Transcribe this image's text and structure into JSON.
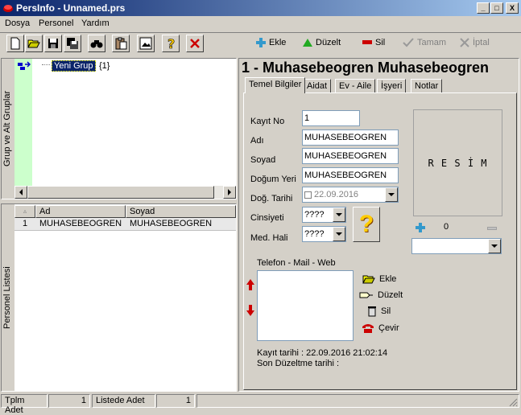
{
  "window": {
    "title": "PersInfo - Unnamed.prs",
    "min": "_",
    "max": "□",
    "close": "X"
  },
  "menu": [
    "Dosya",
    "Personel",
    "Yardım"
  ],
  "actions": {
    "ekle": "Ekle",
    "duzelt": "Düzelt",
    "sil": "Sil",
    "tamam": "Tamam",
    "iptal": "İptal"
  },
  "groups_panel": {
    "label": "Grup ve Alt Gruplar",
    "tree_item": "Yeni Grup",
    "tree_count": "{1}"
  },
  "personel_panel": {
    "label": "Personel Listesi",
    "columns": [
      "Ad",
      "Soyad"
    ],
    "rows": [
      {
        "no": "1",
        "ad": "MUHASEBEOGREN",
        "soyad": "MUHASEBEOGREN"
      }
    ]
  },
  "record": {
    "header": "1 - Muhasebeogren Muhasebeogren",
    "tabs": [
      "Temel Bilgiler",
      "Aidat",
      "Ev - Aile",
      "İşyeri",
      "Notlar"
    ],
    "labels": {
      "kayit_no": "Kayıt No",
      "adi": "Adı",
      "soyad": "Soyad",
      "dogum_yeri": "Doğum Yeri",
      "dog_tarihi": "Doğ. Tarihi",
      "cinsiyeti": "Cinsiyeti",
      "med_hali": "Med. Hali"
    },
    "values": {
      "kayit_no": "1",
      "adi": "MUHASEBEOGREN",
      "soyad": "MUHASEBEOGREN",
      "dogum_yeri": "MUHASEBEOGREN",
      "dog_tarihi": "22.09.2016",
      "cinsiyeti": "????",
      "med_hali": "????"
    },
    "help_mark": "?",
    "photo": {
      "text": "R E S İ M",
      "counter": "0"
    },
    "contact": {
      "label": "Telefon - Mail - Web",
      "ekle": "Ekle",
      "duzelt": "Düzelt",
      "sil": "Sil",
      "cevir": "Çevir"
    },
    "kayit_tarihi": "Kayıt tarihi : 22.09.2016  21:02:14",
    "son_duzeltme": "Son Düzeltme tarihi :"
  },
  "statusbar": {
    "tplm_label": "Tplm Adet",
    "tplm_value": "1",
    "listede_label": "Listede Adet",
    "listede_value": "1"
  }
}
